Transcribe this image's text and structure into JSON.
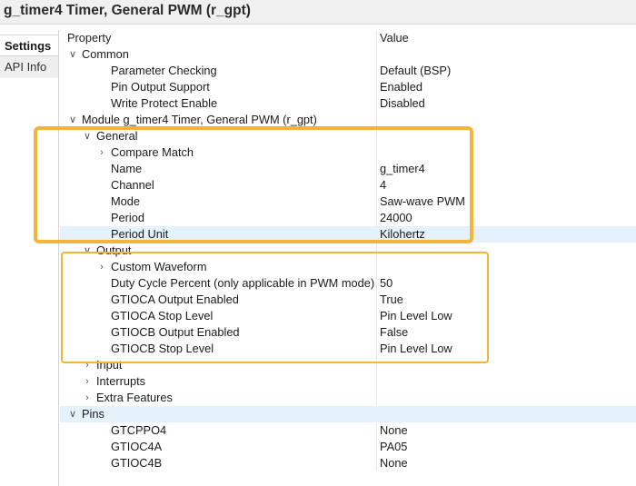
{
  "window": {
    "title": "g_timer4 Timer, General PWM (r_gpt)"
  },
  "side_tabs": [
    {
      "label": "Settings",
      "active": true
    },
    {
      "label": "API Info",
      "active": false
    }
  ],
  "table": {
    "columns": {
      "property": "Property",
      "value": "Value"
    },
    "rows": [
      {
        "label": "Common",
        "value": "",
        "chevron": "expanded"
      },
      {
        "label": "Parameter Checking",
        "value": "Default (BSP)",
        "chevron": "none"
      },
      {
        "label": "Pin Output Support",
        "value": "Enabled",
        "chevron": "none"
      },
      {
        "label": "Write Protect Enable",
        "value": "Disabled",
        "chevron": "none"
      },
      {
        "label": "Module g_timer4 Timer, General PWM (r_gpt)",
        "value": "",
        "chevron": "expanded"
      },
      {
        "label": "General",
        "value": "",
        "chevron": "expanded"
      },
      {
        "label": "Compare Match",
        "value": "",
        "chevron": "collapsed"
      },
      {
        "label": "Name",
        "value": "g_timer4",
        "chevron": "none"
      },
      {
        "label": "Channel",
        "value": "4",
        "chevron": "none"
      },
      {
        "label": "Mode",
        "value": "Saw-wave PWM",
        "chevron": "none"
      },
      {
        "label": "Period",
        "value": "24000",
        "chevron": "none"
      },
      {
        "label": "Period Unit",
        "value": "Kilohertz",
        "chevron": "none",
        "selected": true
      },
      {
        "label": "Output",
        "value": "",
        "chevron": "expanded"
      },
      {
        "label": "Custom Waveform",
        "value": "",
        "chevron": "collapsed"
      },
      {
        "label": "Duty Cycle Percent (only applicable in PWM mode)",
        "value": "50",
        "chevron": "none"
      },
      {
        "label": "GTIOCA Output Enabled",
        "value": "True",
        "chevron": "none"
      },
      {
        "label": "GTIOCA Stop Level",
        "value": "Pin Level Low",
        "chevron": "none"
      },
      {
        "label": "GTIOCB Output Enabled",
        "value": "False",
        "chevron": "none"
      },
      {
        "label": "GTIOCB Stop Level",
        "value": "Pin Level Low",
        "chevron": "none"
      },
      {
        "label": "Input",
        "value": "",
        "chevron": "collapsed"
      },
      {
        "label": "Interrupts",
        "value": "",
        "chevron": "collapsed"
      },
      {
        "label": "Extra Features",
        "value": "",
        "chevron": "collapsed"
      },
      {
        "label": "Pins",
        "value": "",
        "chevron": "expanded",
        "selected": true
      },
      {
        "label": "GTCPPO4",
        "value": "None",
        "chevron": "none"
      },
      {
        "label": "GTIOC4A",
        "value": "PA05",
        "chevron": "none"
      },
      {
        "label": "GTIOC4B",
        "value": "None",
        "chevron": "none"
      }
    ]
  },
  "colors": {
    "highlight_box": "#f4b43a",
    "selection": "#e5f1fb"
  }
}
